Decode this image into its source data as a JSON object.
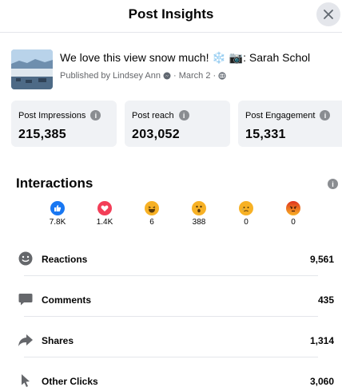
{
  "header": {
    "title": "Post Insights",
    "close_icon": "close-icon"
  },
  "post": {
    "text": "We love this view snow much! ❄️ 📷: Sarah Schol",
    "meta_prefix": "Published by Lindsey Ann",
    "meta_date": "· March 2 ·",
    "meta_icons": [
      "messenger-icon",
      "globe-icon"
    ]
  },
  "stats": [
    {
      "label": "Post Impressions",
      "value": "215,385"
    },
    {
      "label": "Post reach",
      "value": "203,052"
    },
    {
      "label": "Post Engagement",
      "value": "15,331"
    }
  ],
  "interactions": {
    "title": "Interactions",
    "reactions": [
      {
        "name": "like-reaction-icon",
        "count": "7.8K",
        "color": "#1877f2"
      },
      {
        "name": "love-reaction-icon",
        "count": "1.4K",
        "color": "#f33e58"
      },
      {
        "name": "haha-reaction-icon",
        "count": "6",
        "color": "#f7b125"
      },
      {
        "name": "wow-reaction-icon",
        "count": "388",
        "color": "#f7b125"
      },
      {
        "name": "sad-reaction-icon",
        "count": "0",
        "color": "#f7b125"
      },
      {
        "name": "angry-reaction-icon",
        "count": "0",
        "color": "#e9710f"
      }
    ],
    "metrics": [
      {
        "label": "Reactions",
        "value": "9,561",
        "icon": "smiley-icon"
      },
      {
        "label": "Comments",
        "value": "435",
        "icon": "comment-icon"
      },
      {
        "label": "Shares",
        "value": "1,314",
        "icon": "share-arrow-icon"
      },
      {
        "label": "Other Clicks",
        "value": "3,060",
        "icon": "cursor-icon"
      }
    ]
  }
}
